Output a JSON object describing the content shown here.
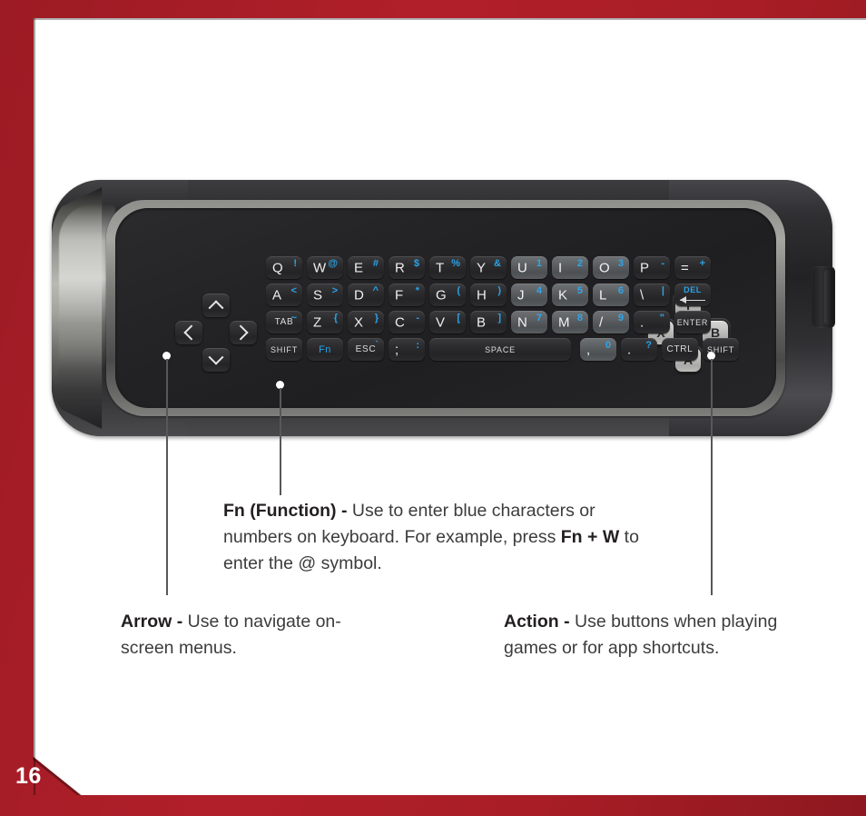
{
  "page": {
    "number": "16",
    "accent_red": "#a21d26",
    "paper": "#ffffff",
    "blue_fn": "#29a3e8",
    "key_text": "#ededed"
  },
  "device": {
    "name": "remote-keyboard",
    "side_button": "side-button"
  },
  "dpad": {
    "up": "chevron-up-icon",
    "down": "chevron-down-icon",
    "left": "chevron-left-icon",
    "right": "chevron-right-icon"
  },
  "action_buttons": [
    {
      "id": "y",
      "label": "Y"
    },
    {
      "id": "x",
      "label": "X"
    },
    {
      "id": "b",
      "label": "B"
    },
    {
      "id": "a",
      "label": "A"
    }
  ],
  "keyboard": {
    "rows": [
      {
        "name": "row-1",
        "keys": [
          {
            "main": "Q",
            "alt": "!",
            "lit": false
          },
          {
            "main": "W",
            "alt": "@",
            "lit": false
          },
          {
            "main": "E",
            "alt": "#",
            "lit": false
          },
          {
            "main": "R",
            "alt": "$",
            "lit": false
          },
          {
            "main": "T",
            "alt": "%",
            "lit": false
          },
          {
            "main": "Y",
            "alt": "&",
            "lit": false
          },
          {
            "main": "U",
            "alt": "1",
            "lit": true
          },
          {
            "main": "I",
            "alt": "2",
            "lit": true
          },
          {
            "main": "O",
            "alt": "3",
            "lit": true
          },
          {
            "main": "P",
            "alt": "-",
            "lit": false
          },
          {
            "main": "=",
            "alt": "+",
            "lit": false
          }
        ]
      },
      {
        "name": "row-2",
        "keys": [
          {
            "main": "A",
            "alt": "<",
            "lit": false
          },
          {
            "main": "S",
            "alt": ">",
            "lit": false
          },
          {
            "main": "D",
            "alt": "^",
            "lit": false
          },
          {
            "main": "F",
            "alt": "*",
            "lit": false
          },
          {
            "main": "G",
            "alt": "(",
            "lit": false
          },
          {
            "main": "H",
            "alt": ")",
            "lit": false
          },
          {
            "main": "J",
            "alt": "4",
            "lit": true
          },
          {
            "main": "K",
            "alt": "5",
            "lit": true
          },
          {
            "main": "L",
            "alt": "6",
            "lit": true
          },
          {
            "main": "\\",
            "alt": "|",
            "lit": false
          },
          {
            "main": "",
            "alt": "",
            "lit": false,
            "special": "DEL"
          }
        ]
      },
      {
        "name": "row-3",
        "keys": [
          {
            "main": "",
            "alt": "~",
            "lit": false,
            "word": "TAB"
          },
          {
            "main": "Z",
            "alt": "{",
            "lit": false
          },
          {
            "main": "X",
            "alt": "}",
            "lit": false
          },
          {
            "main": "C",
            "alt": "-",
            "lit": false
          },
          {
            "main": "V",
            "alt": "[",
            "lit": false
          },
          {
            "main": "B",
            "alt": "]",
            "lit": false
          },
          {
            "main": "N",
            "alt": "7",
            "lit": true
          },
          {
            "main": "M",
            "alt": "8",
            "lit": true
          },
          {
            "main": "/",
            "alt": "9",
            "lit": true
          },
          {
            "main": ".",
            "alt": "\"",
            "lit": false
          },
          {
            "main": "",
            "alt": "",
            "lit": false,
            "word": "ENTER"
          }
        ]
      },
      {
        "name": "row-4",
        "keys": [
          {
            "main": "",
            "alt": "",
            "lit": false,
            "word": "SHIFT"
          },
          {
            "main": "",
            "alt": "",
            "lit": false,
            "word": "Fn",
            "blue": true
          },
          {
            "main": "",
            "alt": "`",
            "lit": false,
            "word": "ESC"
          },
          {
            "main": ";",
            "alt": ":",
            "lit": false
          },
          {
            "main": "",
            "alt": "",
            "lit": false,
            "word": "SPACE"
          },
          {
            "main": ",",
            "alt": "0",
            "lit": true
          },
          {
            "main": ".",
            "alt": "?",
            "lit": false
          },
          {
            "main": "",
            "alt": "",
            "lit": false,
            "word": "CTRL"
          },
          {
            "main": "",
            "alt": "",
            "lit": false,
            "word": "SHIFT"
          }
        ]
      }
    ],
    "del_word": "DEL"
  },
  "captions": {
    "fn": {
      "term": "Fn (Function) -",
      "body_1": " Use to enter blue characters or numbers on keyboard. For example, press ",
      "bold_1": "Fn +",
      "body_2": " ",
      "bold_2": "W",
      "body_3": " to enter the @ symbol."
    },
    "arrow": {
      "term": "Arrow -",
      "body": " Use to navigate on-screen menus."
    },
    "action": {
      "term": "Action -",
      "body": " Use buttons when playing games or for app shortcuts."
    }
  }
}
